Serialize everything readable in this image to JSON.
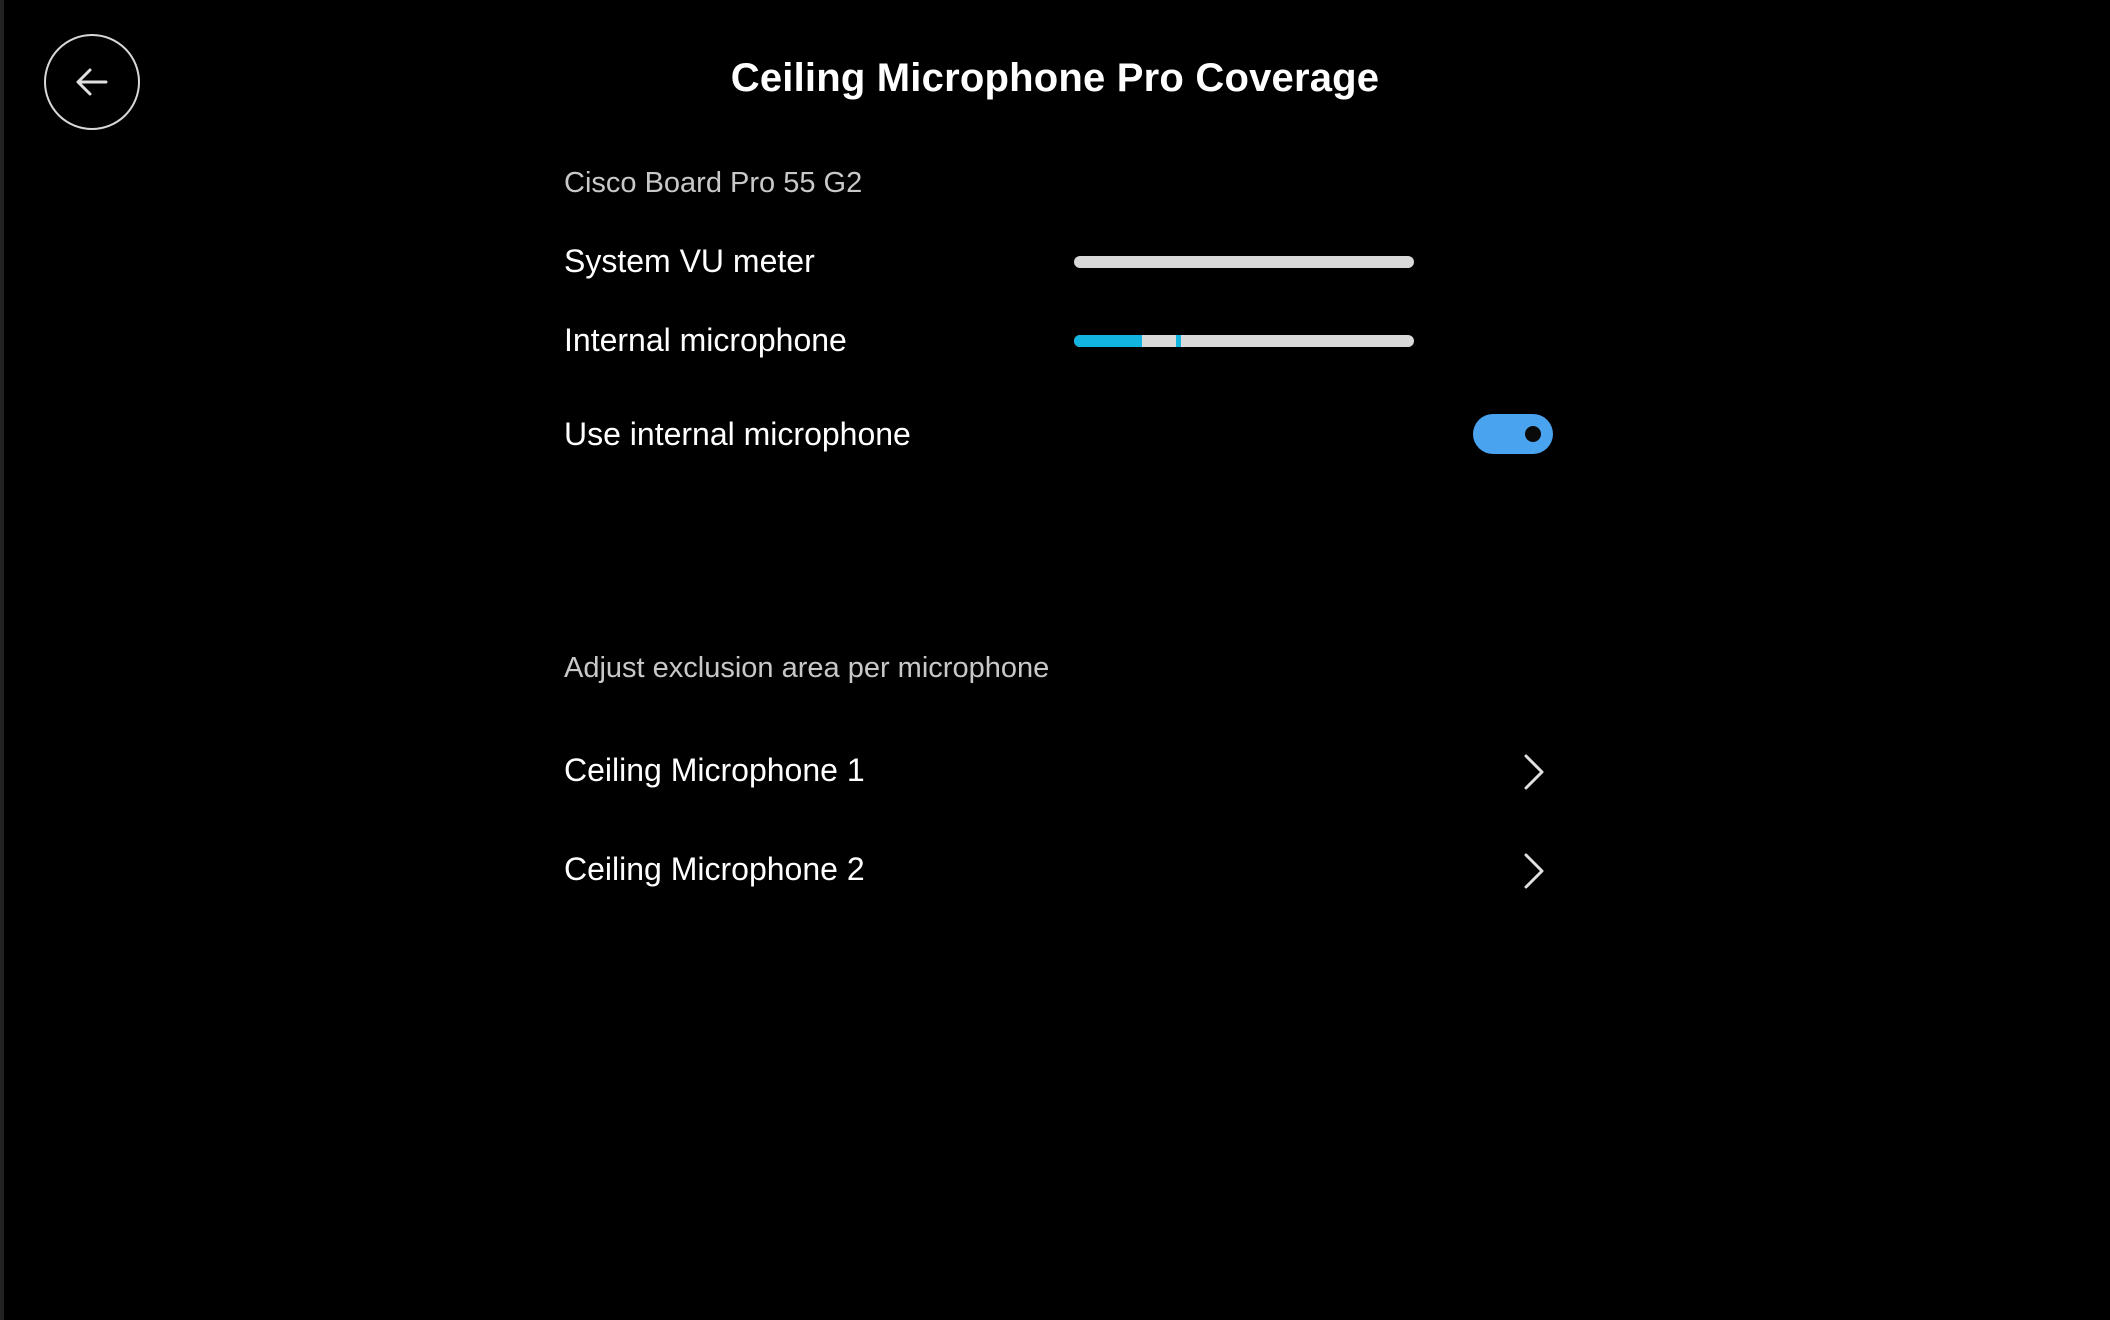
{
  "header": {
    "title": "Ceiling Microphone Pro Coverage"
  },
  "device": {
    "name": "Cisco Board Pro 55 G2"
  },
  "meters": {
    "system_vu": {
      "label": "System VU meter",
      "level": 0.0
    },
    "internal_mic": {
      "label": "Internal microphone",
      "level": 0.2,
      "peak": 0.3
    }
  },
  "toggle": {
    "label": "Use internal microphone",
    "on": true,
    "color": "#4aa3ee"
  },
  "exclusion": {
    "section_label": "Adjust exclusion area per microphone",
    "items": [
      {
        "label": "Ceiling Microphone 1"
      },
      {
        "label": "Ceiling Microphone 2"
      }
    ]
  },
  "colors": {
    "accent": "#12b4e0",
    "toggle_on": "#4aa3ee",
    "background": "#000000"
  }
}
